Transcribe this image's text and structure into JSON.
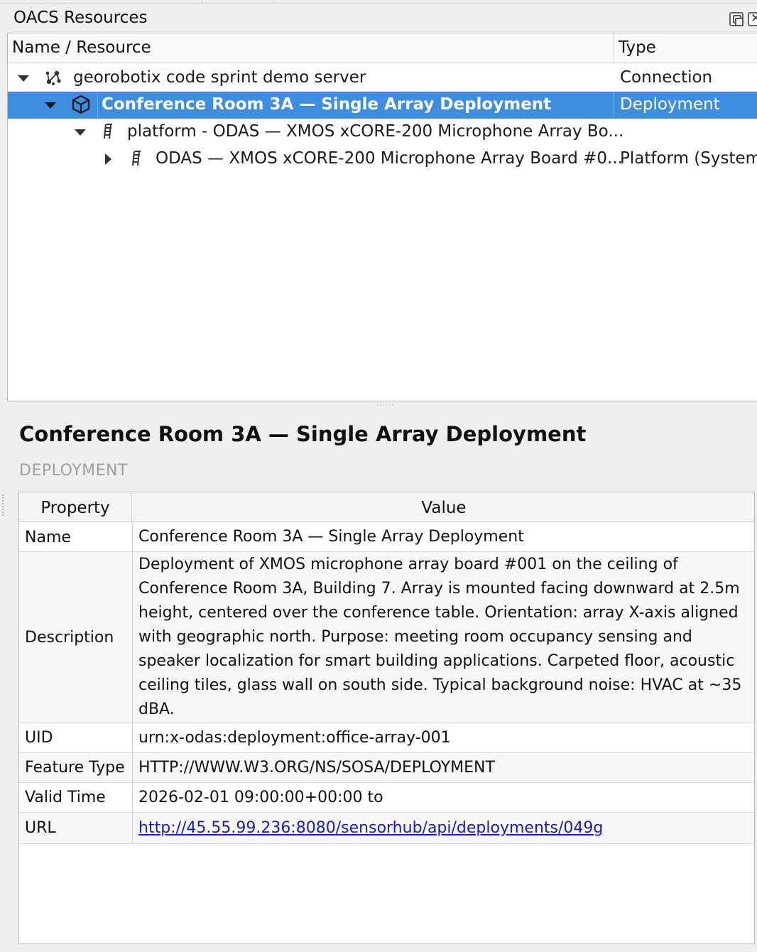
{
  "dock": {
    "title": "OACS Resources"
  },
  "tree": {
    "columns": {
      "name": "Name / Resource",
      "type": "Type"
    },
    "rows": [
      {
        "label": "georobotix code sprint demo server",
        "type": "Connection",
        "icon": "network-icon"
      },
      {
        "label": "Conference Room 3A — Single Array Deployment",
        "type": "Deployment",
        "icon": "cube-icon"
      },
      {
        "label": "platform - ODAS — XMOS xCORE-200 Microphone Array Bo...",
        "type": "",
        "icon": "platform-icon"
      },
      {
        "label": "ODAS — XMOS xCORE-200 Microphone Array Board #0...",
        "type": "Platform (System",
        "icon": "platform-icon"
      }
    ]
  },
  "detail": {
    "title": "Conference Room 3A — Single Array Deployment",
    "kind": "DEPLOYMENT",
    "table": {
      "headers": {
        "property": "Property",
        "value": "Value"
      },
      "rows": [
        {
          "key": "Name",
          "value": "Conference Room 3A — Single Array Deployment"
        },
        {
          "key": "Description",
          "value": "Deployment of XMOS microphone array board #001 on the ceiling of Conference Room 3A, Building 7. Array is mounted facing downward at 2.5m height, centered over the conference table. Orientation: array X-axis aligned with geographic north. Purpose: meeting room occupancy sensing and speaker localization for smart building applications. Carpeted floor, acoustic ceiling tiles, glass wall on south side. Typical background noise: HVAC at ~35 dBA."
        },
        {
          "key": "UID",
          "value": "urn:x-odas:deployment:office-array-001"
        },
        {
          "key": "Feature Type",
          "value": "HTTP://WWW.W3.ORG/NS/SOSA/DEPLOYMENT"
        },
        {
          "key": "Valid Time",
          "value": "2026-02-01 09:00:00+00:00 to"
        },
        {
          "key": "URL",
          "value": "http://45.55.99.236:8080/sensorhub/api/deployments/049g"
        }
      ]
    }
  },
  "colors": {
    "selection": "#3d8ee0",
    "link": "#1a1ac8"
  }
}
